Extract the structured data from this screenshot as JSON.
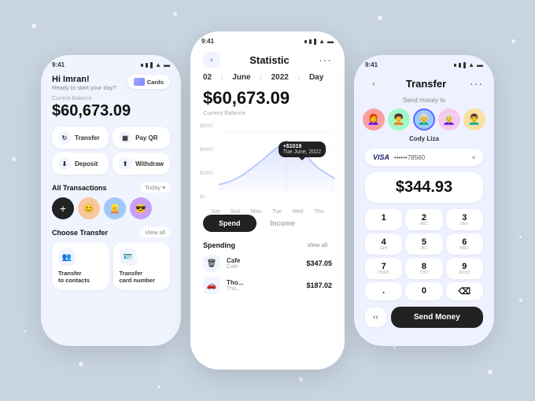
{
  "background_color": "#c8d4e0",
  "left_phone": {
    "time": "9:41",
    "greeting": "Hi Imran!",
    "greeting_sub": "Ready to start your day?",
    "cards_label": "Cards",
    "balance_label": "Current Balance",
    "balance": "$60,673.09",
    "actions": [
      {
        "label": "Transfer",
        "icon": "↻"
      },
      {
        "label": "Pay QR",
        "icon": "▦"
      },
      {
        "label": "Deposit",
        "icon": "⬇"
      },
      {
        "label": "Withdraw",
        "icon": "⬆"
      }
    ],
    "transactions_title": "All Transactions",
    "today_label": "Today ▾",
    "transaction_avatars": [
      "😊",
      "👱",
      "😎"
    ],
    "choose_transfer_title": "Choose Transfer",
    "view_all_label": "View all",
    "transfer_options": [
      {
        "icon": "👥",
        "label": "Transfer\nto contacts"
      },
      {
        "icon": "🪪",
        "label": "Transfer\ncard number"
      }
    ]
  },
  "middle_phone": {
    "time": "9:41",
    "title": "Statistic",
    "date": {
      "day": "02",
      "month": "June",
      "year": "2022",
      "view": "Day"
    },
    "balance": "$60,673.09",
    "balance_label": "Current Balance",
    "chart": {
      "y_labels": [
        "$9000",
        "$6000",
        "$3000",
        "$0"
      ],
      "x_labels": [
        "Sat",
        "Sun",
        "Mon",
        "Tue",
        "Wed",
        "Thu"
      ],
      "tooltip_value": "+$1019",
      "tooltip_date": "Tue June, 2022"
    },
    "tabs": [
      "Spend",
      "Income"
    ],
    "active_tab": "Spend",
    "spending_title": "Spending",
    "view_all": "View all",
    "spending_items": [
      {
        "icon": "🗑",
        "name": "Cafe",
        "sub": "Cafe",
        "amount": "$347.05"
      },
      {
        "icon": "🚗",
        "name": "Tho...",
        "sub": "Tho...",
        "amount": "$187.02"
      }
    ]
  },
  "right_phone": {
    "time": "9:41",
    "title": "Transfer",
    "send_to_label": "Send money to",
    "avatars": [
      "👩‍🦰",
      "🧑‍🦱",
      "👨‍🦳",
      "👩‍🦳",
      "👨‍🦱"
    ],
    "selected_avatar": "👨‍🦳",
    "selected_name": "Cody Liza",
    "visa_label": "VISA",
    "card_number": "••••••78560",
    "amount": "$344.93",
    "numpad": [
      {
        "main": "1",
        "sub": ""
      },
      {
        "main": "2",
        "sub": "ABC"
      },
      {
        "main": "3",
        "sub": "DEF"
      },
      {
        "main": "4",
        "sub": "GHI"
      },
      {
        "main": "5",
        "sub": "JKL"
      },
      {
        "main": "6",
        "sub": "MNO"
      },
      {
        "main": "7",
        "sub": "PQRS"
      },
      {
        "main": "8",
        "sub": "TUV"
      },
      {
        "main": "9",
        "sub": "WXYZ"
      },
      {
        "main": ".",
        "sub": ""
      },
      {
        "main": "0",
        "sub": ""
      },
      {
        "main": "⌫",
        "sub": ""
      }
    ],
    "back_arrows": "< <",
    "send_button": "Send Money"
  }
}
